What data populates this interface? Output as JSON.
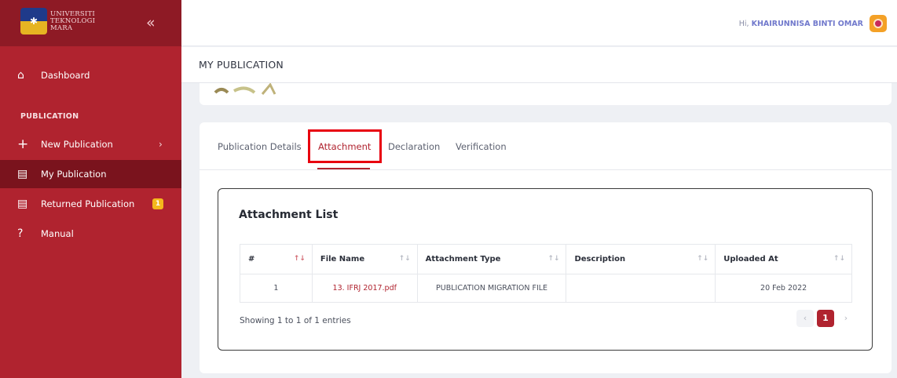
{
  "sidebar": {
    "logo": {
      "line1": "UNIVERSITI",
      "line2": "TEKNOLOGI",
      "line3": "MARA"
    },
    "collapse_icon": "double-chevron-left",
    "items": [
      {
        "label": "Dashboard",
        "icon": "home-icon"
      },
      {
        "label": "New Publication",
        "icon": "plus-icon"
      },
      {
        "label": "My Publication",
        "icon": "clipboard-icon"
      },
      {
        "label": "Returned Publication",
        "icon": "clipboard-icon",
        "badge": "1"
      },
      {
        "label": "Manual",
        "icon": "help-circle-icon"
      }
    ],
    "section_label": "PUBLICATION"
  },
  "header": {
    "greeting": "Hi,",
    "user_name": "KHAIRUNNISA BINTI OMAR",
    "page_title": "MY PUBLICATION"
  },
  "tabs": [
    {
      "label": "Publication Details"
    },
    {
      "label": "Attachment",
      "active": true
    },
    {
      "label": "Declaration"
    },
    {
      "label": "Verification"
    }
  ],
  "attachment_list": {
    "title": "Attachment List",
    "columns": [
      "#",
      "File Name",
      "Attachment Type",
      "Description",
      "Uploaded At"
    ],
    "rows": [
      {
        "num": "1",
        "file": "13. IFRJ 2017.pdf",
        "type": "PUBLICATION MIGRATION FILE",
        "description": "",
        "uploaded": "20 Feb 2022"
      }
    ],
    "showing": "Showing 1 to 1 of 1 entries",
    "pagination": {
      "prev": "‹",
      "current": "1",
      "next": "›"
    }
  },
  "colors": {
    "primary": "#b0232f",
    "sidebar_dark": "#7a131d",
    "highlight": "#e8000f",
    "badge": "#f4b81c"
  }
}
